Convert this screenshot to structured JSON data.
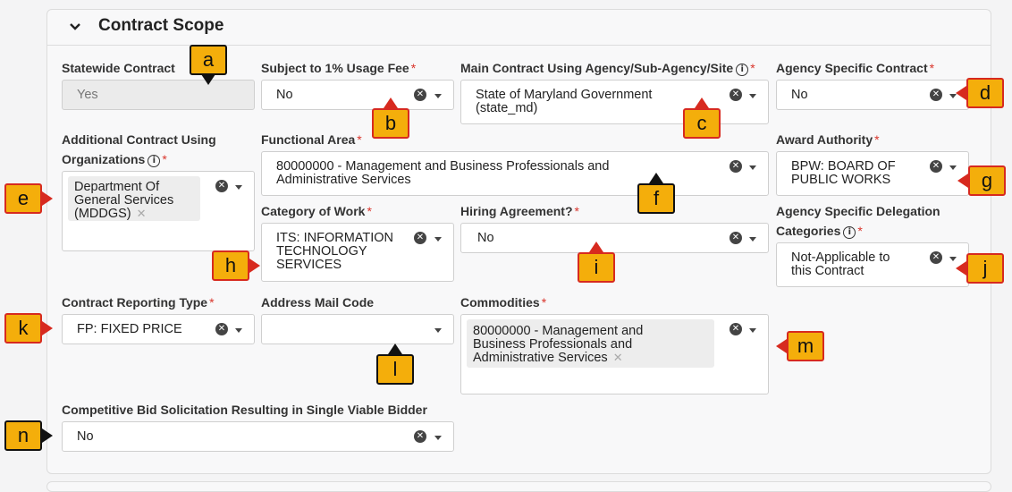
{
  "section": {
    "title": "Contract Scope"
  },
  "fields": {
    "statewide": {
      "label": "Statewide Contract",
      "value": "Yes"
    },
    "usage_fee": {
      "label": "Subject to 1% Usage Fee",
      "value": "No"
    },
    "main_agency": {
      "label": "Main Contract Using Agency/Sub-Agency/Site",
      "value_line1": "State of Maryland Government",
      "value_line2": "(state_md)"
    },
    "agency_specific": {
      "label": "Agency Specific Contract",
      "value": "No"
    },
    "additional_orgs": {
      "label_line1": "Additional Contract Using",
      "label_line2": "Organizations",
      "chip_line1": "Department Of",
      "chip_line2": "General Services",
      "chip_line3": "(MDDGS)"
    },
    "functional_area": {
      "label": "Functional Area",
      "value_line1": "80000000 - Management and Business Professionals and",
      "value_line2": "Administrative Services"
    },
    "award_authority": {
      "label": "Award Authority",
      "value_line1": "BPW: BOARD OF",
      "value_line2": "PUBLIC WORKS"
    },
    "category_work": {
      "label": "Category of Work",
      "value_line1": "ITS: INFORMATION",
      "value_line2": "TECHNOLOGY",
      "value_line3": "SERVICES"
    },
    "hiring": {
      "label": "Hiring Agreement?",
      "value": "No"
    },
    "delegation": {
      "label_line1": "Agency Specific Delegation",
      "label_line2": "Categories",
      "value_line1": "Not-Applicable to",
      "value_line2": "this Contract"
    },
    "reporting_type": {
      "label": "Contract Reporting Type",
      "value": "FP: FIXED PRICE"
    },
    "mail_code": {
      "label": "Address Mail Code",
      "value": ""
    },
    "commodities": {
      "label": "Commodities",
      "chip_line1": "80000000 - Management and",
      "chip_line2": "Business Professionals and",
      "chip_line3": "Administrative Services"
    },
    "competitive_bid": {
      "label": "Competitive Bid Solicitation Resulting in Single Viable Bidder",
      "value": "No"
    }
  },
  "callouts": [
    "a",
    "b",
    "c",
    "d",
    "e",
    "f",
    "g",
    "h",
    "i",
    "j",
    "k",
    "l",
    "m",
    "n"
  ],
  "colors": {
    "callout_fill": "#f4ae0b",
    "callout_border": "#d72a1f",
    "required": "#d9342b"
  }
}
